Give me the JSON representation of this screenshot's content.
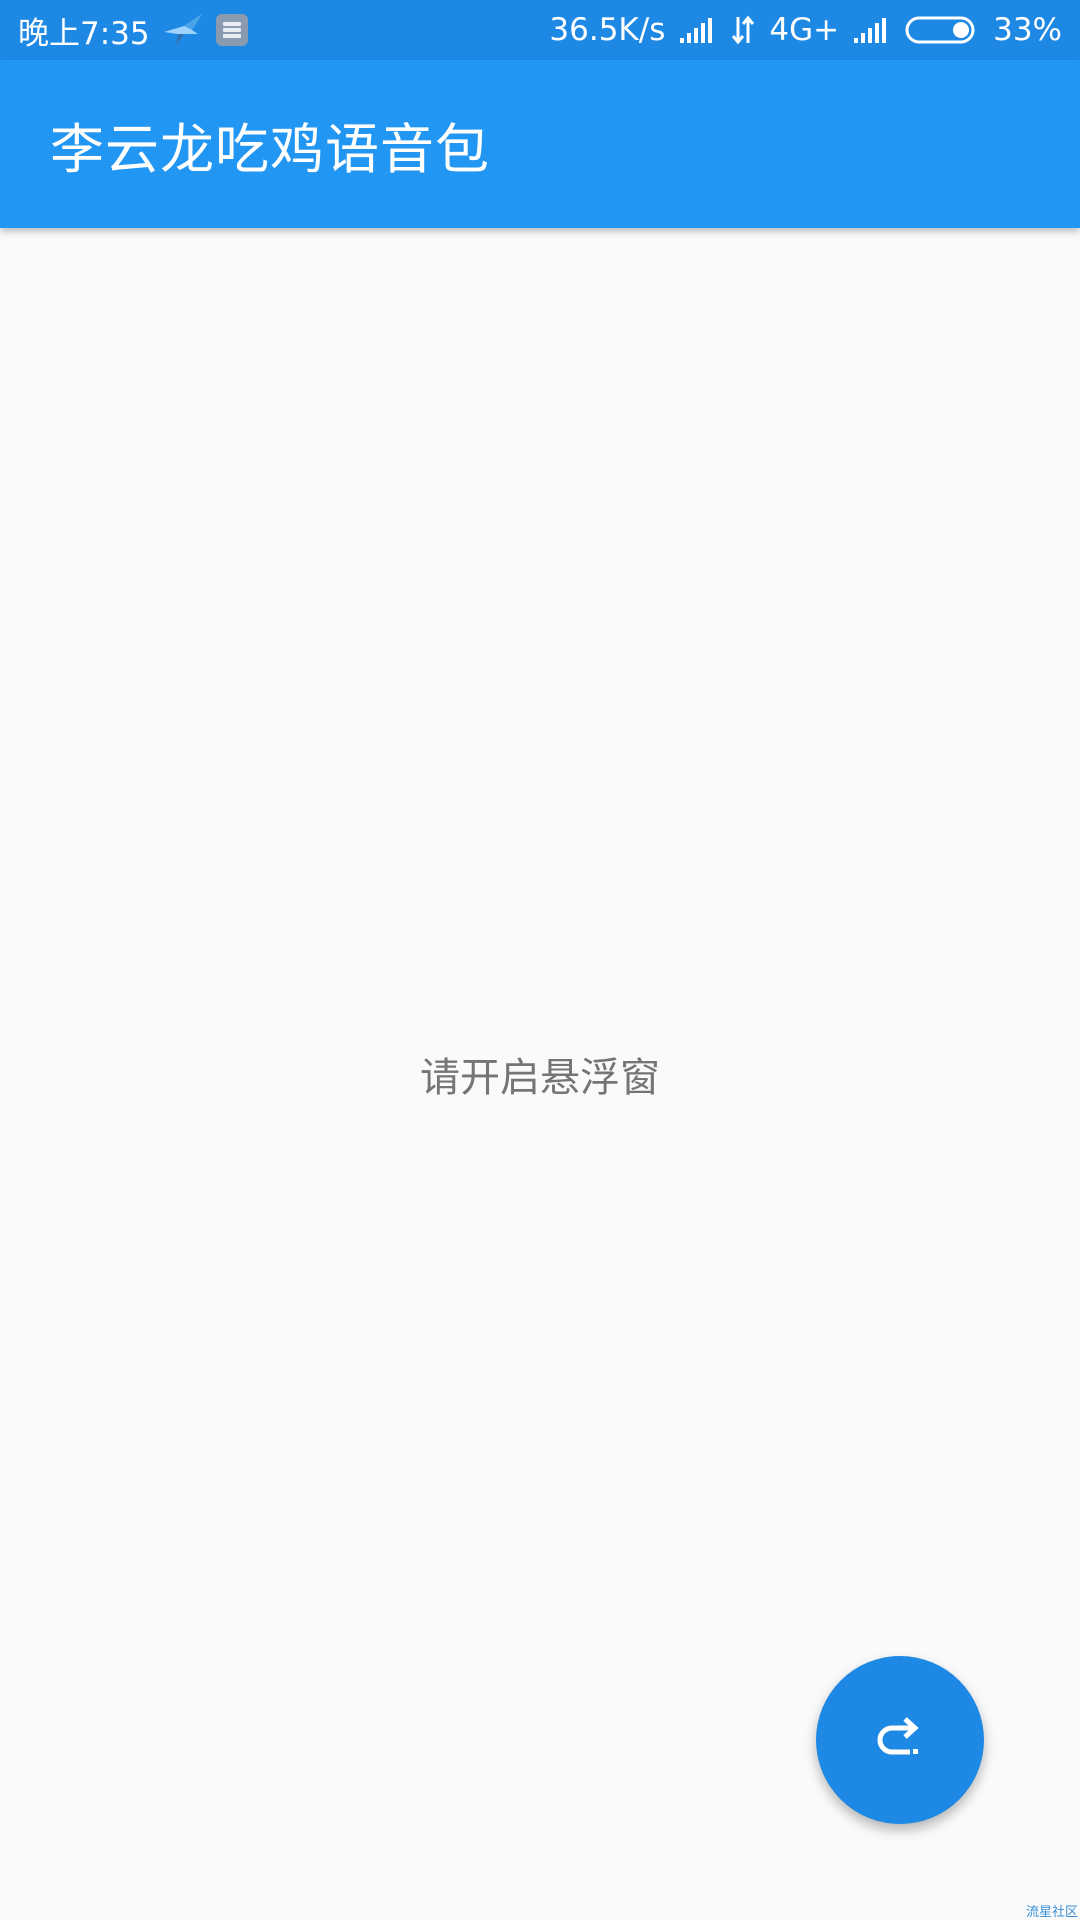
{
  "status_bar": {
    "time": "晚上7:35",
    "network_speed": "36.5K/s",
    "network_type": "4G+",
    "battery_percent": "33%",
    "battery_level": 0.33,
    "icons": [
      "bird-icon",
      "notification-icon",
      "signal-icon",
      "data-transfer-icon",
      "signal-icon",
      "battery-icon"
    ]
  },
  "app_bar": {
    "title": "李云龙吃鸡语音包"
  },
  "main": {
    "message": "请开启悬浮窗"
  },
  "fab": {
    "icon": "redo-icon"
  },
  "watermark": {
    "text": "流星社区"
  },
  "colors": {
    "status_bar": "#1e88e5",
    "app_bar": "#2196f3",
    "background": "#fafafa",
    "fab": "#1e88e5",
    "message_text": "#757575"
  }
}
